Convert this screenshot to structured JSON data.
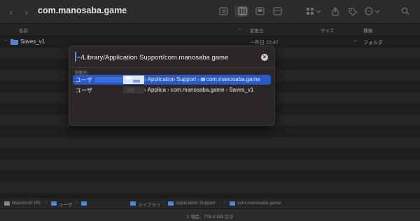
{
  "window": {
    "title": "com.manosaba.game",
    "back_glyph": "‹",
    "forward_glyph": "›"
  },
  "toolbar": {
    "icons": [
      "view-list-icon",
      "view-columns-icon",
      "view-gallery-icon",
      "view-icon-grid-icon",
      "group-icon",
      "share-icon",
      "tag-icon",
      "action-icon",
      "search-icon"
    ]
  },
  "columns": {
    "name": "名前",
    "date_modified": "変更日",
    "size": "サイズ",
    "kind": "種類",
    "sort_glyph": "⌄"
  },
  "files": [
    {
      "name": "Saves_v1",
      "date": "一昨日 22:47",
      "size": "--",
      "kind": "フォルダ",
      "disclosure": "›"
    }
  ],
  "goto": {
    "input_value": "~/Library/Application Support/com.manosaba.game",
    "clear_glyph": "×",
    "heading": "移動先:",
    "suggestions": [
      {
        "user": "ユーザ",
        "parts": [
          "Application Support",
          "com.manosaba.game"
        ],
        "selected": true
      },
      {
        "user": "ユーザ",
        "parts": [
          "Applica",
          "com.manosaba.game",
          "Saves_v1"
        ],
        "selected": false
      }
    ]
  },
  "pathbar": {
    "items": [
      "Macintosh HD",
      "ユーザ",
      "ライブラリ",
      "Application Support",
      "com.manosaba.game"
    ],
    "separator": "›"
  },
  "status": {
    "text": "1 項目、778.8 GB 空き"
  },
  "colors": {
    "accent": "#2a5ac9",
    "folder": "#4a8bd6",
    "window_bg": "#1e1e1e",
    "dialog_bg": "#2c2727"
  }
}
